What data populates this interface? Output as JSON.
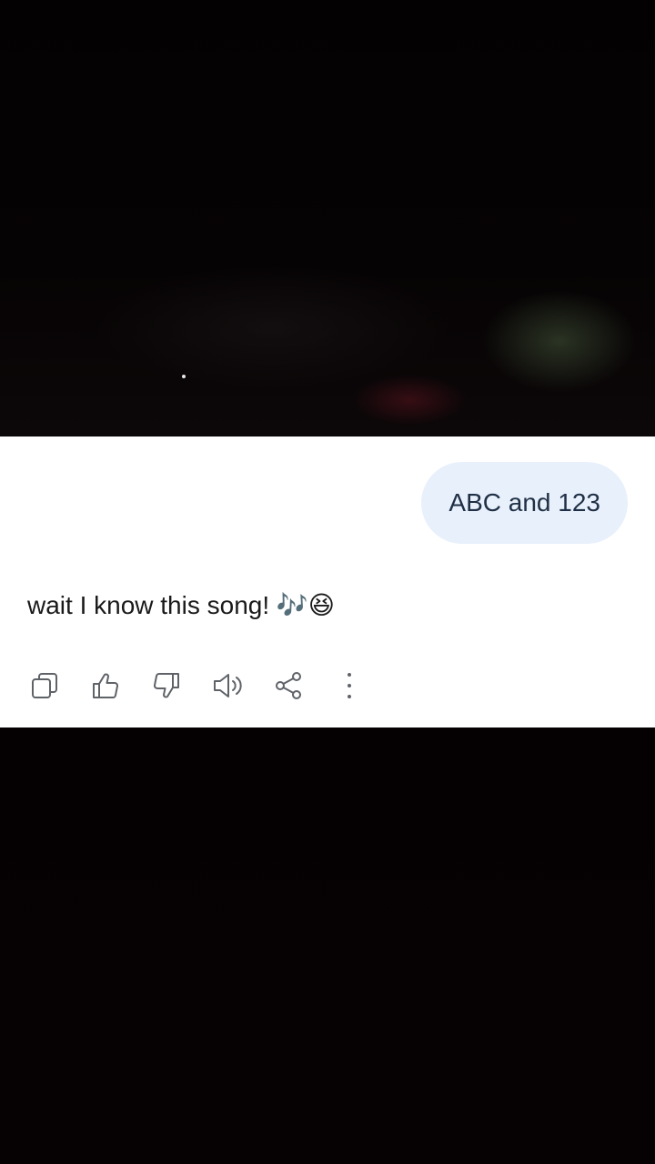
{
  "messages": {
    "user": "ABC and 123",
    "bot_text": "wait I know this song!",
    "bot_emoji": "🎶😆"
  },
  "actions": [
    {
      "name": "copy",
      "icon": "copy-icon"
    },
    {
      "name": "thumbs-up",
      "icon": "thumbs-up-icon"
    },
    {
      "name": "thumbs-down",
      "icon": "thumbs-down-icon"
    },
    {
      "name": "read-aloud",
      "icon": "speaker-icon"
    },
    {
      "name": "share",
      "icon": "share-icon"
    },
    {
      "name": "more",
      "icon": "more-vert-icon"
    }
  ],
  "colors": {
    "user_bubble": "#e8f0fb",
    "user_text": "#1f2f45",
    "icon": "#5f6368",
    "background": "#050203"
  }
}
